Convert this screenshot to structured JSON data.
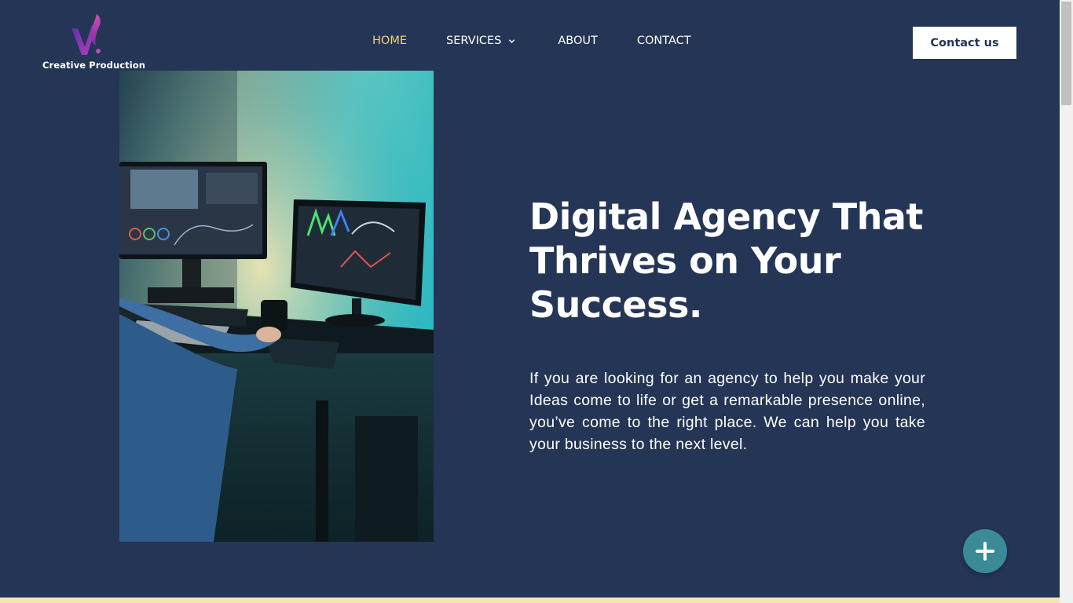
{
  "brand": {
    "name": "Creative Production"
  },
  "nav": {
    "items": [
      {
        "label": "HOME",
        "active": true
      },
      {
        "label": "SERVICES",
        "has_dropdown": true
      },
      {
        "label": "ABOUT"
      },
      {
        "label": "CONTACT"
      }
    ],
    "active_color": "#f2d27a"
  },
  "header": {
    "cta_label": "Contact us"
  },
  "hero": {
    "title": "Digital Agency That Thrives on Your Success.",
    "body": "If you are looking for an agency to help you make your Ideas come to life or get a remarkable presence online, you’ve come to the right place. We can help you take your business to the next level.",
    "image_description": "video-editing-workstation-photo"
  },
  "fab": {
    "icon": "plus-icon",
    "color": "#3b8a97"
  },
  "colors": {
    "background": "#243555",
    "accent_strip": "#f4e6b3"
  }
}
